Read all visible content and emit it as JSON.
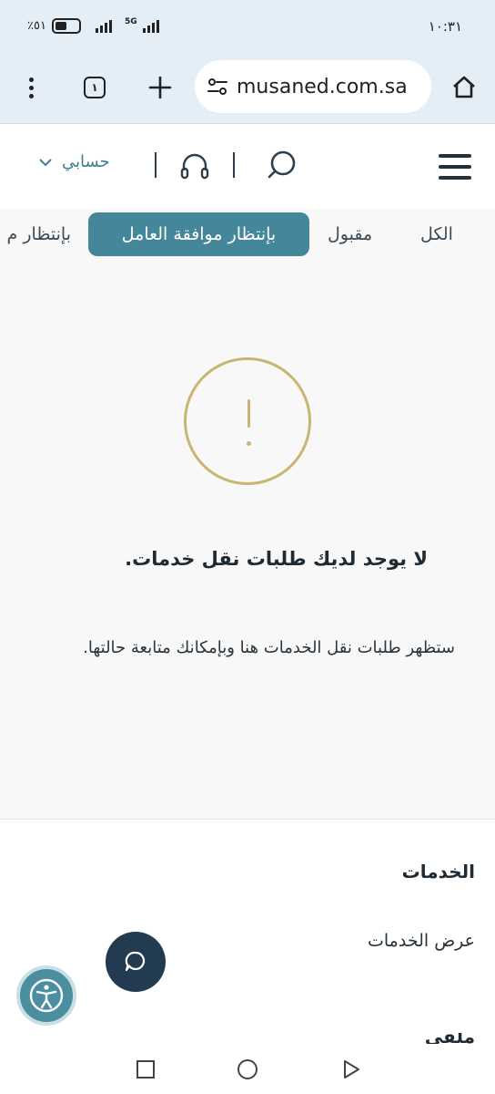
{
  "status_bar": {
    "time": "١٠:٣١",
    "battery_text": "٪٥١",
    "battery_level": 0.51,
    "network": "5G"
  },
  "browser": {
    "tab_count": "١",
    "url": "musaned.com.sa",
    "icons": [
      "more-vert-icon",
      "tabs-icon",
      "plus-icon",
      "site-settings-icon",
      "home-icon"
    ]
  },
  "header": {
    "account_label": "حسابي",
    "icons": [
      "search-icon",
      "headset-icon",
      "chevron-down-icon",
      "hamburger-icon"
    ]
  },
  "filter_tabs": [
    {
      "label": "الكل",
      "active": false
    },
    {
      "label": "مقبول",
      "active": false
    },
    {
      "label": "بإنتظار موافقة العامل",
      "active": true
    },
    {
      "label": "بإنتظار م",
      "active": false
    }
  ],
  "empty_state": {
    "icon": "warning-circle-icon",
    "title": "لا يوجد لديك طلبات نقل خدمات.",
    "description": "ستظهر طلبات نقل الخدمات هنا وبإمكانك متابعة حالتها."
  },
  "footer": {
    "section_title": "الخدمات",
    "link": "عرض الخدمات",
    "cut_off_text": "ملفي الشخصي"
  },
  "colors": {
    "accent": "#45879a",
    "warning": "#c8b672",
    "chat_button": "#233b50",
    "a11y_button": "#4a8ea0"
  }
}
